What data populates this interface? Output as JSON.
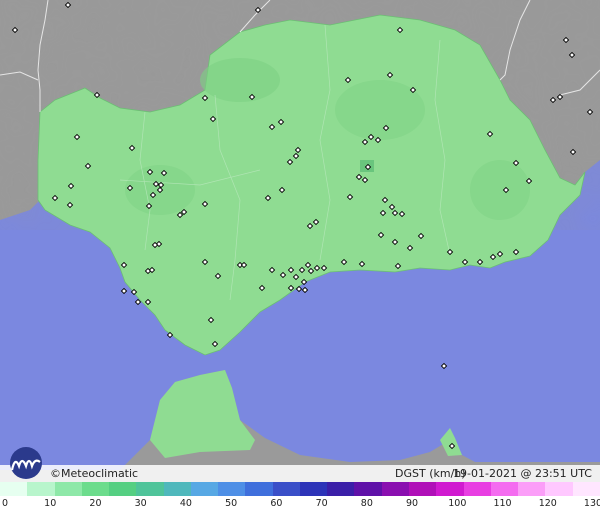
{
  "brand": {
    "name": "©Meteoclimatic",
    "logo": "meteoclimatic-logo-icon"
  },
  "parameter_label": "DGST (km/h)",
  "timestamp": "19-01-2021 @ 23:51 UTC",
  "legend": {
    "ticks": [
      "0",
      "10",
      "20",
      "30",
      "40",
      "50",
      "60",
      "70",
      "80",
      "90",
      "100",
      "110",
      "120",
      "130"
    ],
    "colors": [
      "#e6fff0",
      "#b8f5cc",
      "#8ee8a8",
      "#6cdc8c",
      "#55cf82",
      "#4fc49a",
      "#4fb8bc",
      "#57a8e4",
      "#4e8fe6",
      "#3f6fdc",
      "#3a4fc8",
      "#2d34b8",
      "#3b1fa8",
      "#5f11a8",
      "#8a0fb0",
      "#b010b8",
      "#d01ad0",
      "#e83ee2",
      "#f46cf0",
      "#fb9ef8",
      "#ffc8ff",
      "#ffe6ff"
    ]
  },
  "colors": {
    "sea": "#7b88e0",
    "land_outside": "#9a9a9a",
    "region": "#8fdc92",
    "border": "#e8e8e8"
  }
}
